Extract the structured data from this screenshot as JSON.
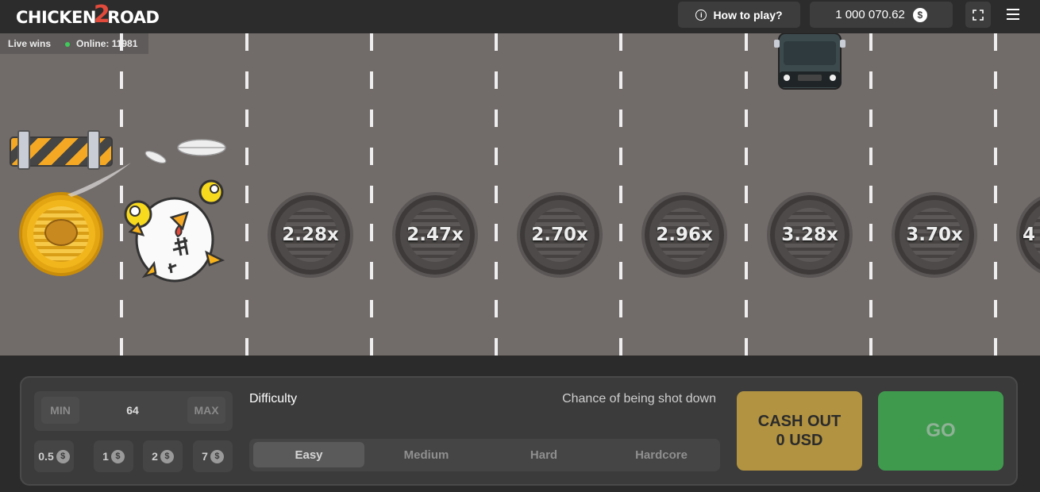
{
  "header": {
    "logo_left": "CHICKEN",
    "logo_two": "2",
    "logo_right": "ROAD",
    "how_to_play_label": "How to play?",
    "balance": "1 000 070.62",
    "currency_symbol": "$"
  },
  "stats": {
    "live_wins_label": "Live wins",
    "online_label": "Online: 11981"
  },
  "multipliers": [
    "2.28x",
    "2.47x",
    "2.70x",
    "2.96x",
    "3.28x",
    "3.70x",
    "4"
  ],
  "bet": {
    "min_label": "MIN",
    "value": "64",
    "max_label": "MAX",
    "chips": [
      {
        "amount": "0.5",
        "symbol": "$"
      },
      {
        "amount": "1",
        "symbol": "$"
      },
      {
        "amount": "2",
        "symbol": "$"
      },
      {
        "amount": "7",
        "symbol": "$"
      }
    ]
  },
  "difficulty": {
    "label": "Difficulty",
    "chance_label": "Chance of being shot down",
    "options": [
      "Easy",
      "Medium",
      "Hard",
      "Hardcore"
    ],
    "selected": "Easy"
  },
  "actions": {
    "cashout_line1": "CASH OUT",
    "cashout_line2": "0 USD",
    "go_label": "GO"
  },
  "colors": {
    "road": "#716b69",
    "cashout": "#b29341",
    "go": "#3f9a4e",
    "online_dot": "#3fcb5a"
  }
}
